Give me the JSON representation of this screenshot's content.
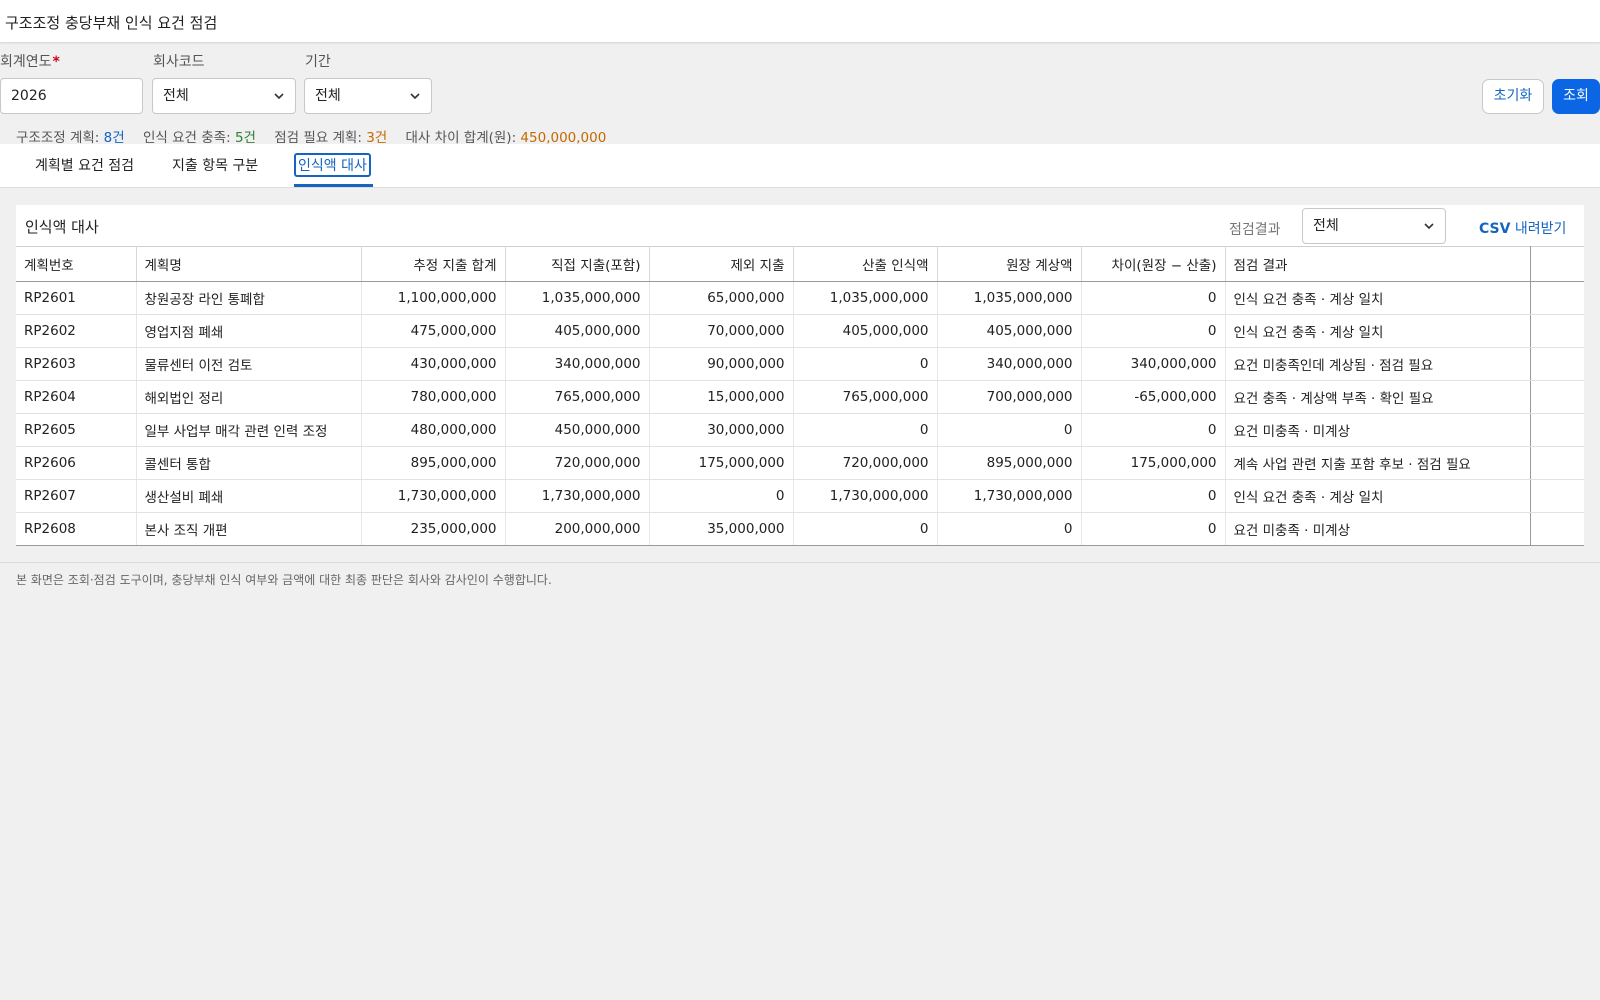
{
  "header": {
    "title": "구조조정 충당부채 인식 요건 점검"
  },
  "filters": {
    "fiscal_year": {
      "label": "회계연도",
      "required_mark": "*",
      "value": "2026"
    },
    "company_code": {
      "label": "회사코드",
      "value": "전체"
    },
    "period": {
      "label": "기간",
      "value": "전체"
    },
    "reset_label": "초기화",
    "search_label": "조회"
  },
  "summary": {
    "plans_label": "구조조정 계획:",
    "plans_value": "8건",
    "met_label": "인식 요건 충족:",
    "met_value": "5건",
    "review_label": "점검 필요 계획:",
    "review_value": "3건",
    "diff_label": "대사 차이 합계(원):",
    "diff_value": "450,000,000"
  },
  "tabs": [
    {
      "label": "계획별 요건 점검"
    },
    {
      "label": "지출 항목 구분"
    },
    {
      "label": "인식액 대사"
    }
  ],
  "panel": {
    "title": "인식액 대사",
    "filter_label": "점검결과",
    "filter_value": "전체",
    "csv_prefix": "CSV",
    "csv_suffix": "내려받기"
  },
  "table": {
    "columns": [
      "계획번호",
      "계획명",
      "추정 지출 합계",
      "직접 지출(포함)",
      "제외 지출",
      "산출 인식액",
      "원장 계상액",
      "차이(원장 − 산출)",
      "점검 결과"
    ],
    "rows": [
      [
        "RP2601",
        "창원공장 라인 통폐합",
        "1,100,000,000",
        "1,035,000,000",
        "65,000,000",
        "1,035,000,000",
        "1,035,000,000",
        "0",
        "인식 요건 충족 · 계상 일치"
      ],
      [
        "RP2602",
        "영업지점 폐쇄",
        "475,000,000",
        "405,000,000",
        "70,000,000",
        "405,000,000",
        "405,000,000",
        "0",
        "인식 요건 충족 · 계상 일치"
      ],
      [
        "RP2603",
        "물류센터 이전 검토",
        "430,000,000",
        "340,000,000",
        "90,000,000",
        "0",
        "340,000,000",
        "340,000,000",
        "요건 미충족인데 계상됨 · 점검 필요"
      ],
      [
        "RP2604",
        "해외법인 정리",
        "780,000,000",
        "765,000,000",
        "15,000,000",
        "765,000,000",
        "700,000,000",
        "-65,000,000",
        "요건 충족 · 계상액 부족 · 확인 필요"
      ],
      [
        "RP2605",
        "일부 사업부 매각 관련 인력 조정",
        "480,000,000",
        "450,000,000",
        "30,000,000",
        "0",
        "0",
        "0",
        "요건 미충족 · 미계상"
      ],
      [
        "RP2606",
        "콜센터 통합",
        "895,000,000",
        "720,000,000",
        "175,000,000",
        "720,000,000",
        "895,000,000",
        "175,000,000",
        "계속 사업 관련 지출 포함 후보 · 점검 필요"
      ],
      [
        "RP2607",
        "생산설비 폐쇄",
        "1,730,000,000",
        "1,730,000,000",
        "0",
        "1,730,000,000",
        "1,730,000,000",
        "0",
        "인식 요건 충족 · 계상 일치"
      ],
      [
        "RP2608",
        "본사 조직 개편",
        "235,000,000",
        "200,000,000",
        "35,000,000",
        "0",
        "0",
        "0",
        "요건 미충족 · 미계상"
      ]
    ],
    "status": [
      "ok",
      "ok",
      "bad",
      "bad",
      "ok",
      "bad",
      "ok",
      "ok"
    ]
  },
  "colors": {
    "accent": "#1565c0",
    "primary_button": "#0a66e4",
    "ok": "#2e7d32",
    "bad": "#c62828",
    "warn": "#c26a00"
  },
  "footnote": "본 화면은 조회·점검 도구이며, 충당부채 인식 여부와 금액에 대한 최종 판단은 회사와 감사인이 수행합니다."
}
